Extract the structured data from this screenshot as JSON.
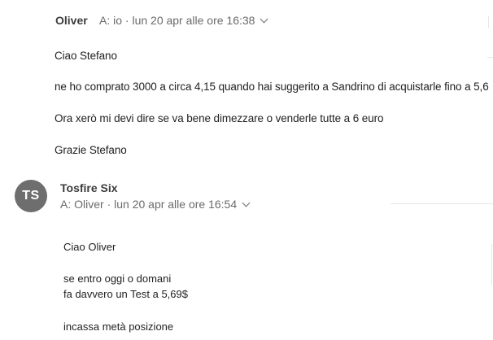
{
  "message1": {
    "sender": "Oliver",
    "recipient_line": "A:  io · lun 20 apr alle ore 16:38",
    "body": [
      "Ciao Stefano",
      "ne ho comprato 3000 a circa 4,15 quando hai suggerito a Sandrino di acquistarle fino a 5,6",
      "Ora xerò mi devi dire se va bene dimezzare  o venderle tutte a 6 euro",
      "Grazie Stefano"
    ]
  },
  "message2": {
    "avatar_initials": "TS",
    "sender": "Tosfire Six",
    "recipient_line": "A:  Oliver · lun 20 apr alle ore 16:54",
    "body": [
      "Ciao Oliver",
      "se entro oggi o domani",
      "fa davvero un Test a 5,69$",
      "incassa metà posizione"
    ]
  },
  "colors": {
    "avatar_bg": "#6e6e6e",
    "meta_text": "#6b6b6b",
    "sender_text": "#3c3c3c"
  },
  "icons": {
    "details_toggle": "chevron-down-icon"
  }
}
